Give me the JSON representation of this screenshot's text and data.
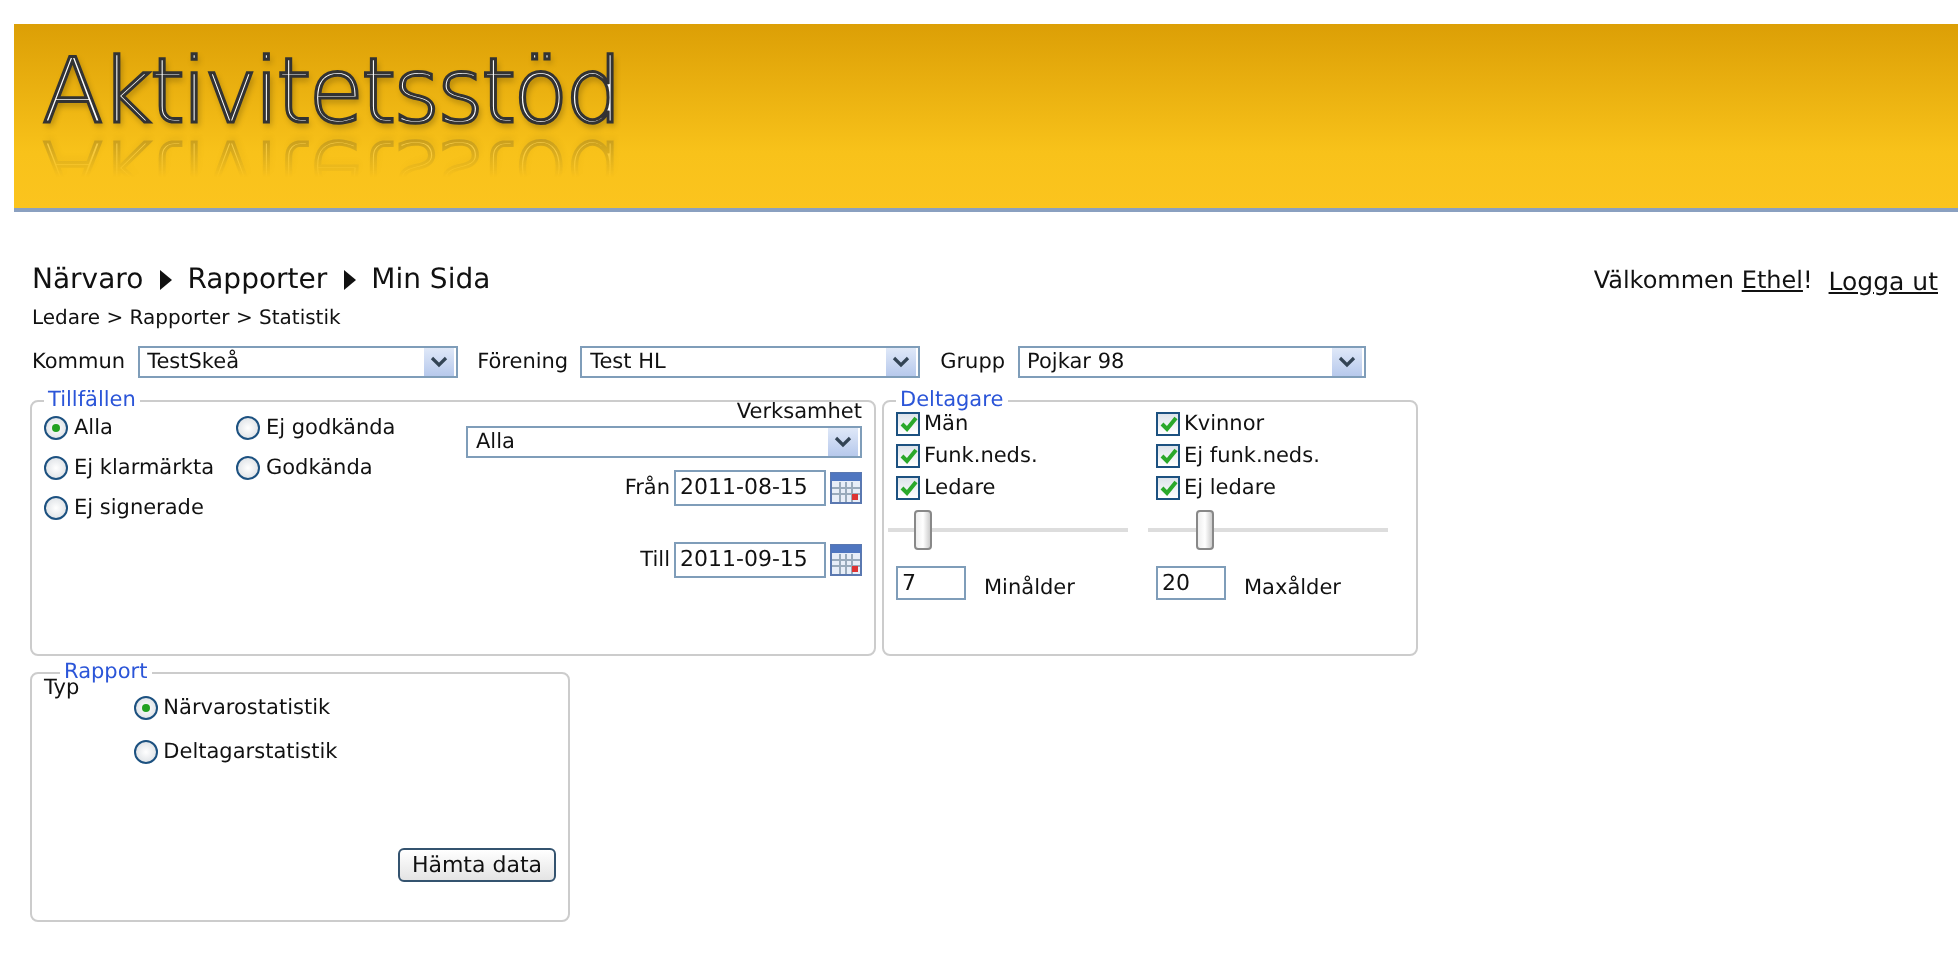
{
  "header": {
    "logo": "Aktivitetsstöd"
  },
  "nav": [
    "Närvaro",
    "Rapporter",
    "Min Sida"
  ],
  "user": {
    "greeting": "Välkommen",
    "name": "Ethel",
    "suffix": "!",
    "logout": "Logga ut"
  },
  "breadcrumb": "Ledare > Rapporter > Statistik",
  "filters": [
    {
      "label": "Kommun",
      "value": "TestSkeå"
    },
    {
      "label": "Förening",
      "value": "Test HL"
    },
    {
      "label": "Grupp",
      "value": "Pojkar 98"
    }
  ],
  "tillfallen": {
    "legend": "Tillfällen",
    "options": [
      {
        "label": "Alla",
        "selected": true
      },
      {
        "label": "Ej godkända",
        "selected": false
      },
      {
        "label": "Ej klarmärkta",
        "selected": false
      },
      {
        "label": "Godkända",
        "selected": false
      },
      {
        "label": "Ej signerade",
        "selected": false
      }
    ],
    "verksamhet": {
      "label": "Verksamhet",
      "value": "Alla"
    },
    "from": {
      "label": "Från",
      "value": "2011-08-15"
    },
    "to": {
      "label": "Till",
      "value": "2011-09-15"
    }
  },
  "deltagare": {
    "legend": "Deltagare",
    "checks": [
      {
        "label": "Män",
        "checked": true
      },
      {
        "label": "Kvinnor",
        "checked": true
      },
      {
        "label": "Funk.neds.",
        "checked": true
      },
      {
        "label": "Ej funk.neds.",
        "checked": true
      },
      {
        "label": "Ledare",
        "checked": true
      },
      {
        "label": "Ej ledare",
        "checked": true
      }
    ],
    "ages": [
      {
        "label": "Minålder",
        "value": "7",
        "level": 0.12
      },
      {
        "label": "Maxålder",
        "value": "20",
        "level": 0.22
      }
    ]
  },
  "rapport": {
    "legend": "Rapport",
    "type_label": "Typ",
    "options": [
      {
        "label": "Närvarostatistik",
        "selected": true
      },
      {
        "label": "Deltagarstatistik",
        "selected": false
      }
    ],
    "button": "Hämta data"
  }
}
